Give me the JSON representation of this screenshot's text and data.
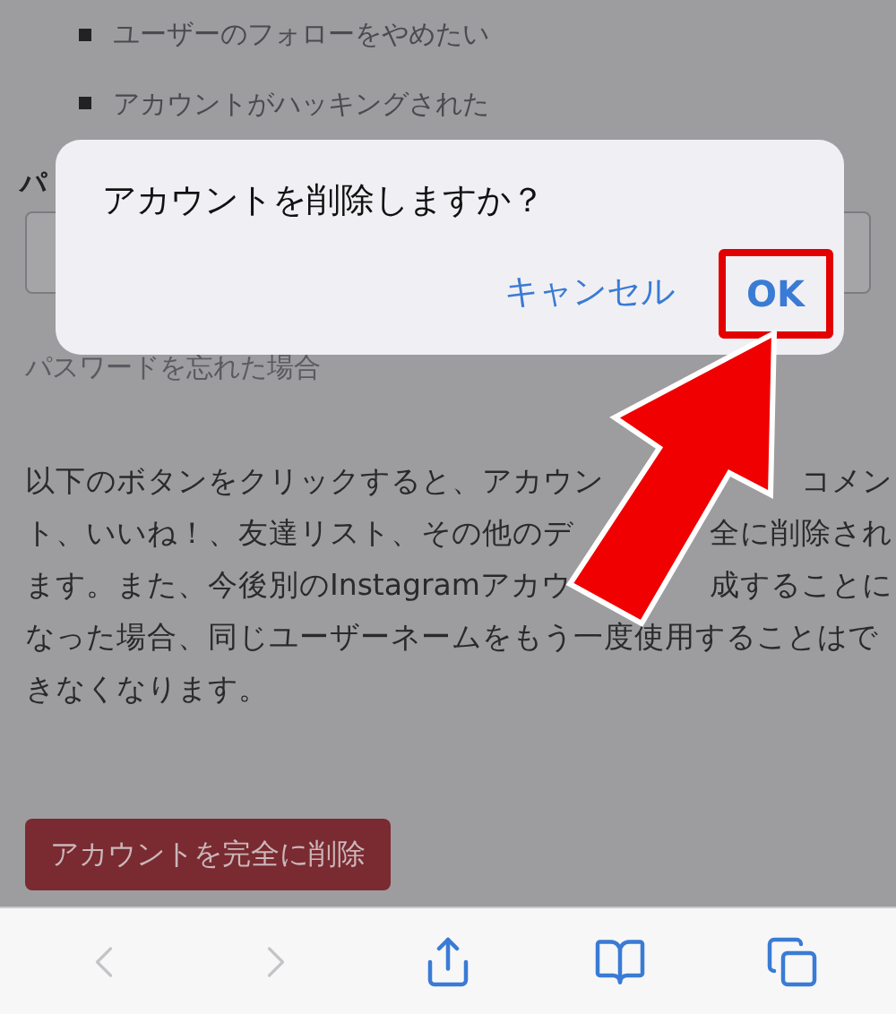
{
  "page": {
    "list_items": [
      "ユーザーのフォローをやめたい",
      "アカウントがハッキングされた"
    ],
    "heading": "パ",
    "link": "パスワードを忘れた場合",
    "paragraph_lines": [
      {
        "left": "以下のボタンをクリックすると、アカウン",
        "right": "コメン"
      },
      {
        "left": "ト、いいね！、友達リスト、その他のデ",
        "right": "全に削除され"
      },
      {
        "left": "ます。また、今後別のInstagramアカウ",
        "right": "成することに"
      },
      {
        "left": "なった場合、同じユーザーネームをもう一度使用することはで"
      },
      {
        "left": "きなくなります。"
      }
    ],
    "delete_button": "アカウントを完全に削除"
  },
  "dialog": {
    "title": "アカウントを削除しますか？",
    "buttons": [
      {
        "label": "キャンセル",
        "highlighted": false
      },
      {
        "label": "OK",
        "highlighted": true
      }
    ]
  },
  "toolbar": [
    {
      "kind": "back",
      "disabled": true
    },
    {
      "kind": "forward",
      "disabled": true
    },
    {
      "kind": "share",
      "disabled": false
    },
    {
      "kind": "bookmarks",
      "disabled": false
    },
    {
      "kind": "tabs",
      "disabled": false
    }
  ]
}
